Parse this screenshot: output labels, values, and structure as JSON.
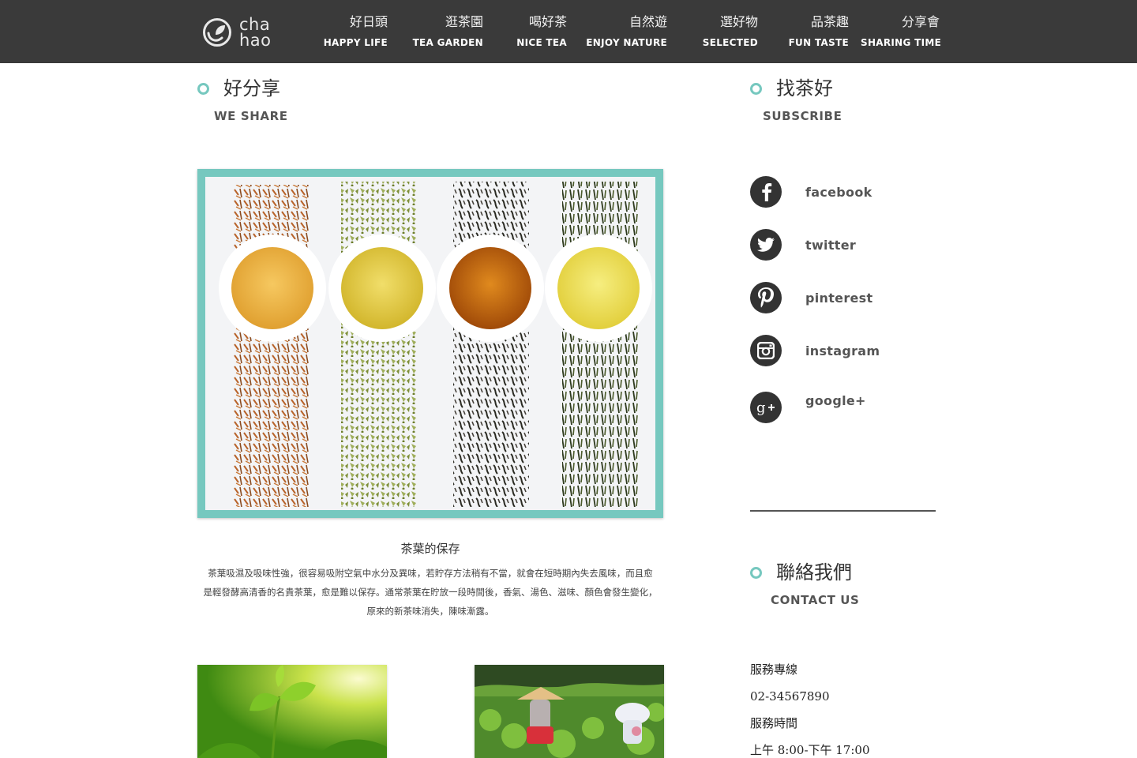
{
  "header": {
    "logo": {
      "line1": "cha",
      "line2": "hao"
    },
    "nav": [
      {
        "zh": "好日頭",
        "en": "HAPPY LIFE"
      },
      {
        "zh": "逛茶園",
        "en": "TEA GARDEN"
      },
      {
        "zh": "喝好茶",
        "en": "NICE TEA"
      },
      {
        "zh": "自然遊",
        "en": "ENJOY NATURE"
      },
      {
        "zh": "選好物",
        "en": "SELECTED"
      },
      {
        "zh": "品茶趣",
        "en": "FUN TASTE"
      },
      {
        "zh": "分享會",
        "en": "SHARING TIME"
      }
    ]
  },
  "share": {
    "title_zh": "好分享",
    "title_en": "WE SHARE",
    "article_title": "茶葉的保存",
    "article_lines": [
      "茶葉吸濕及吸味性強，很容易吸附空氣中水分及異味，若貯存方法稍有不當，就會在短時期內失去風味，而且愈",
      "是輕發酵高清香的名貴茶葉，愈是難以保存。通常茶葉在貯放一段時間後，香氣、湯色、滋味、顏色會發生變化，",
      "原來的新茶味消失，陳味漸露。"
    ]
  },
  "subscribe": {
    "title_zh": "找茶好",
    "title_en": "SUBSCRIBE",
    "items": [
      {
        "label": "facebook",
        "icon": "facebook-icon"
      },
      {
        "label": "twitter",
        "icon": "twitter-icon"
      },
      {
        "label": "pinterest",
        "icon": "pinterest-icon"
      },
      {
        "label": "instagram",
        "icon": "instagram-icon"
      },
      {
        "label": "google+",
        "icon": "google-plus-icon"
      }
    ]
  },
  "contact": {
    "title_zh": "聯絡我們",
    "title_en": "CONTACT US",
    "hotline_label": "服務專線",
    "hotline": "02-34567890",
    "hours_label": "服務時間",
    "hours": "上午 8:00-下午 17:00"
  },
  "colors": {
    "topbar": "#3a3a3a",
    "accent": "#76c8bf",
    "icon_bg": "#333333"
  }
}
